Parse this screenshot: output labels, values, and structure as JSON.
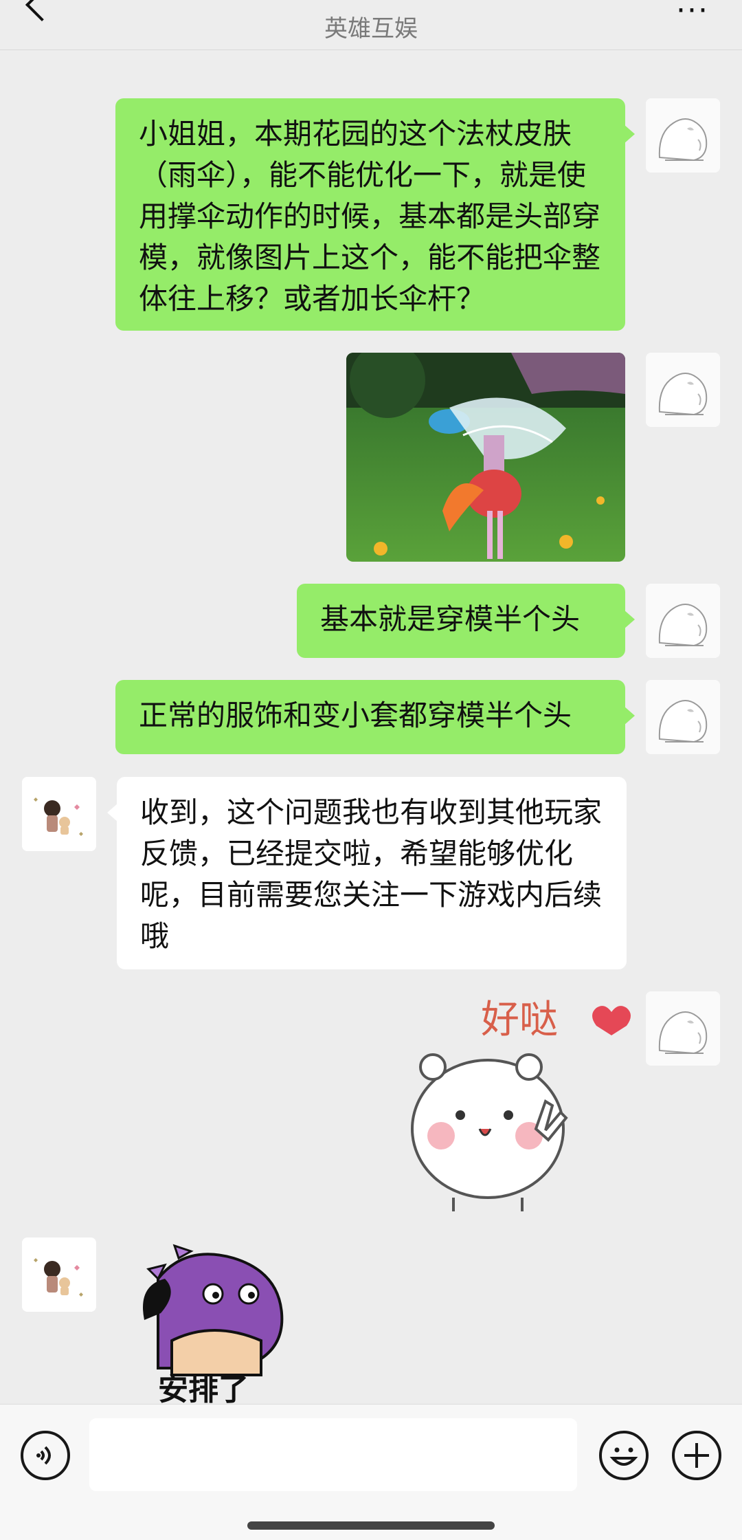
{
  "header": {
    "title": "",
    "subtitle": "英雄互娱",
    "back_icon": "chevron-left-icon",
    "more_icon": "more-dots-icon"
  },
  "messages": [
    {
      "side": "right",
      "type": "text",
      "text": "小姐姐，本期花园的这个法杖皮肤（雨伞），能不能优化一下，就是使用撑伞动作的时候，基本都是头部穿模，就像图片上这个，能不能把伞整体往上移？或者加长伞杆？"
    },
    {
      "side": "right",
      "type": "image",
      "description": "screenshot"
    },
    {
      "side": "right",
      "type": "text",
      "text": "基本就是穿模半个头"
    },
    {
      "side": "right",
      "type": "text",
      "text": "正常的服饰和变小套都穿模半个头"
    },
    {
      "side": "left",
      "type": "text",
      "text": "收到，这个问题我也有收到其他玩家反馈，已经提交啦，希望能够优化呢，目前需要您关注一下游戏内后续哦"
    },
    {
      "side": "right",
      "type": "sticker",
      "text": "好哒"
    },
    {
      "side": "left",
      "type": "sticker",
      "text": "安排了"
    }
  ],
  "input_bar": {
    "voice_icon": "voice-icon",
    "emoji_icon": "emoji-icon",
    "plus_icon": "plus-icon",
    "value": ""
  },
  "colors": {
    "bubble_self": "#95ec69",
    "bubble_other": "#ffffff",
    "background": "#ededed"
  }
}
